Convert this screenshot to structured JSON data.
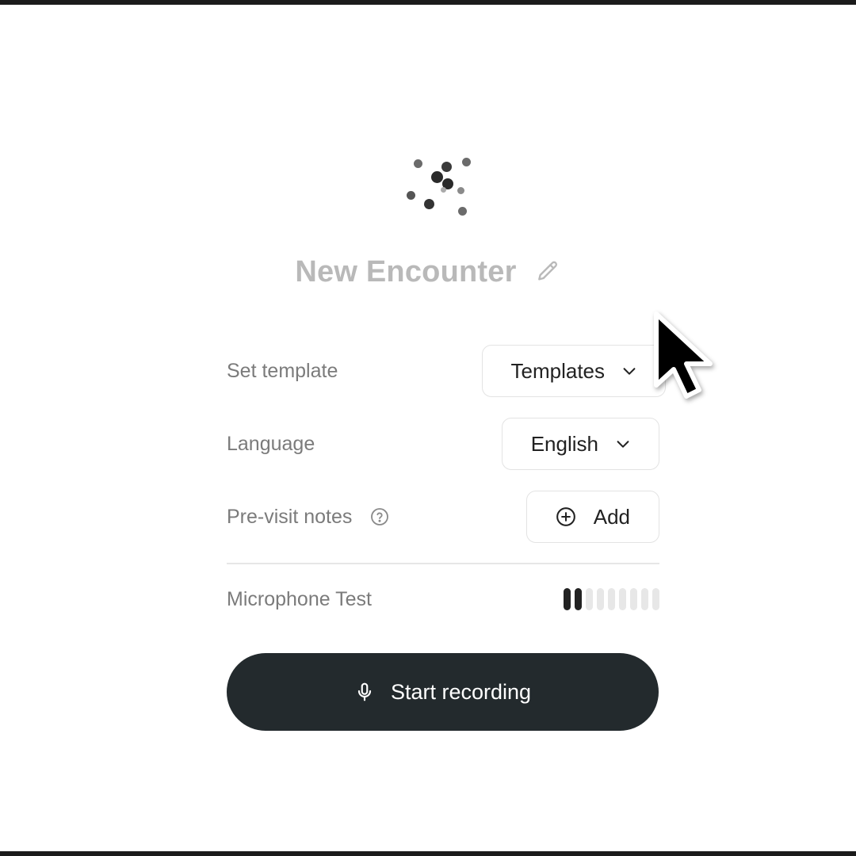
{
  "title": "New Encounter",
  "form": {
    "template": {
      "label": "Set template",
      "value": "Templates"
    },
    "language": {
      "label": "Language",
      "value": "English"
    },
    "previsit": {
      "label": "Pre-visit notes",
      "action": "Add"
    },
    "microphone": {
      "label": "Microphone Test",
      "level_bars_active": 2,
      "level_bars_total": 9
    }
  },
  "record_button": {
    "label": "Start recording"
  },
  "icons": {
    "title_edit": "pencil-icon",
    "template_chevron": "chevron-down-icon",
    "language_chevron": "chevron-down-icon",
    "previsit_help": "question-circle-icon",
    "add": "plus-circle-icon",
    "record": "microphone-icon",
    "loading": "loading-spinner",
    "pointer": "mouse-cursor"
  },
  "colors": {
    "primary_button": "#232a2d",
    "title_text": "#b9b9b9",
    "label_text": "#7b7b7b",
    "meter_active": "#222222",
    "meter_inactive": "#e7e7e7"
  }
}
